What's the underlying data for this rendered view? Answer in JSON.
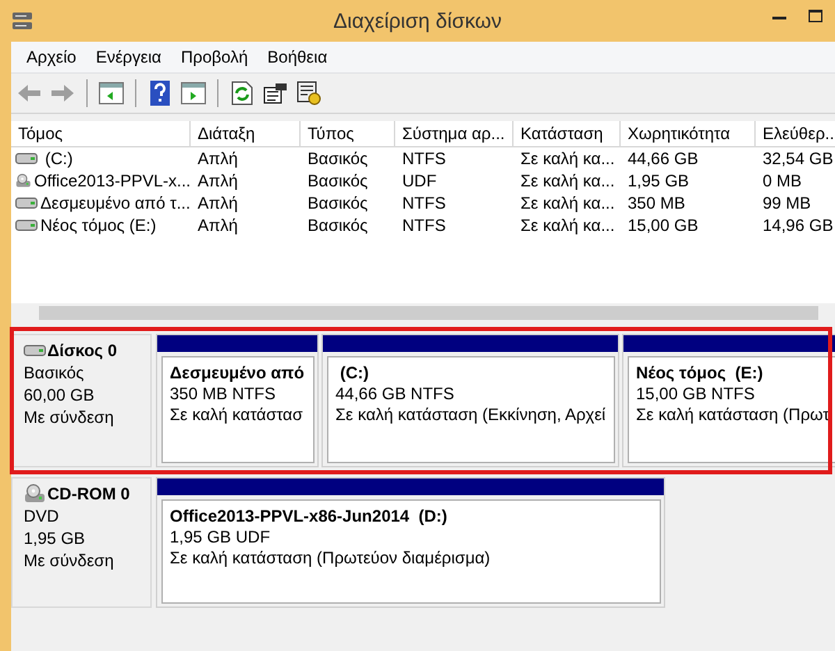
{
  "window": {
    "title": "Διαχείριση δίσκων"
  },
  "menu": [
    "Αρχείο",
    "Ενέργεια",
    "Προβολή",
    "Βοήθεια"
  ],
  "toolbar": [
    {
      "kind": "back",
      "disabled": true
    },
    {
      "kind": "forward",
      "disabled": true
    },
    {
      "kind": "sep"
    },
    {
      "kind": "tree"
    },
    {
      "kind": "sep"
    },
    {
      "kind": "help"
    },
    {
      "kind": "pane"
    },
    {
      "kind": "sep"
    },
    {
      "kind": "refresh"
    },
    {
      "kind": "properties"
    },
    {
      "kind": "settings"
    }
  ],
  "table": {
    "columns": [
      "Τόμος",
      "Διάταξη",
      "Τύπος",
      "Σύστημα αρ...",
      "Κατάσταση",
      "Χωρητικότητα",
      "Ελεύθερ..."
    ],
    "rows": [
      {
        "kind": "drive",
        "cells": [
          " (C:)",
          "Απλή",
          "Βασικός",
          "NTFS",
          "Σε καλή κα...",
          "44,66 GB",
          "32,54 GB"
        ]
      },
      {
        "kind": "disc",
        "cells": [
          "Office2013-PPVL-x...",
          "Απλή",
          "Βασικός",
          "UDF",
          "Σε καλή κα...",
          "1,95 GB",
          "0 MB"
        ]
      },
      {
        "kind": "drive",
        "cells": [
          "Δεσμευμένο από τ...",
          "Απλή",
          "Βασικός",
          "NTFS",
          "Σε καλή κα...",
          "350 MB",
          "99 MB"
        ]
      },
      {
        "kind": "drive",
        "cells": [
          "Νέος τόμος (E:)",
          "Απλή",
          "Βασικός",
          "NTFS",
          "Σε καλή κα...",
          "15,00 GB",
          "14,96 GB"
        ]
      }
    ]
  },
  "disks": [
    {
      "kind": "drive",
      "name": "Δίσκος 0",
      "highlighted": true,
      "lines": [
        "Βασικός",
        "60,00 GB",
        "Με σύνδεση"
      ],
      "partitions": [
        {
          "name": "Δεσμευμένο από",
          "size": "350 MB NTFS",
          "status": "Σε καλή κατάστασ"
        },
        {
          "name": " (C:)",
          "size": "44,66 GB NTFS",
          "status": "Σε καλή κατάσταση (Εκκίνηση, Αρχεί"
        },
        {
          "name": "Νέος τόμος  (E:)",
          "size": "15,00 GB NTFS",
          "status": "Σε καλή κατάσταση (Πρωτ"
        }
      ]
    },
    {
      "kind": "disc",
      "name": "CD-ROM 0",
      "highlighted": false,
      "lines": [
        "DVD",
        "1,95 GB",
        "Με σύνδεση"
      ],
      "partitions": [
        {
          "name": "Office2013-PPVL-x86-Jun2014  (D:)",
          "size": "1,95 GB UDF",
          "status": "Σε καλή κατάσταση (Πρωτεύον διαμέρισμα)"
        }
      ]
    }
  ]
}
